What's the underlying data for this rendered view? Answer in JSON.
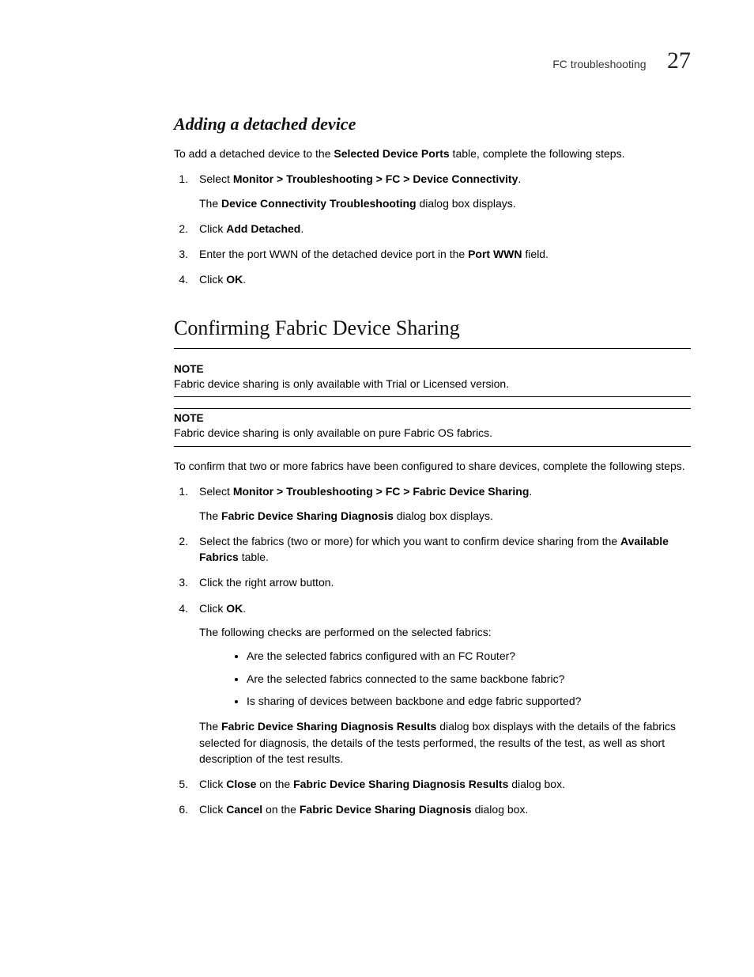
{
  "header": {
    "running_title": "FC troubleshooting",
    "chapter_number": "27"
  },
  "section1": {
    "heading": "Adding a detached device",
    "intro_pre": "To add a detached device to the ",
    "intro_bold": "Selected Device Ports",
    "intro_post": " table, complete the following steps.",
    "steps": {
      "s1_pre": "Select ",
      "s1_bold": "Monitor > Troubleshooting > FC > Device Connectivity",
      "s1_post": ".",
      "s1_sub_pre": "The ",
      "s1_sub_bold": "Device Connectivity Troubleshooting",
      "s1_sub_post": " dialog box displays.",
      "s2_pre": "Click ",
      "s2_bold": "Add Detached",
      "s2_post": ".",
      "s3_pre": "Enter the port WWN of the detached device port in the ",
      "s3_bold": "Port WWN",
      "s3_post": " field.",
      "s4_pre": "Click ",
      "s4_bold": "OK",
      "s4_post": "."
    }
  },
  "section2": {
    "heading": "Confirming Fabric Device Sharing",
    "note1": {
      "label": "NOTE",
      "text": "Fabric device sharing is only available with Trial or Licensed version."
    },
    "note2": {
      "label": "NOTE",
      "text": "Fabric device sharing is only available on pure Fabric OS fabrics."
    },
    "intro": "To confirm that two or more fabrics have been configured to share devices, complete the following steps.",
    "steps": {
      "s1_pre": "Select ",
      "s1_bold": "Monitor > Troubleshooting > FC > Fabric Device Sharing",
      "s1_post": ".",
      "s1_sub_pre": "The ",
      "s1_sub_bold": "Fabric Device Sharing Diagnosis",
      "s1_sub_post": " dialog box displays.",
      "s2_pre": "Select the fabrics (two or more) for which you want to confirm device sharing from the ",
      "s2_bold": "Available Fabrics",
      "s2_post": " table.",
      "s3": "Click the right arrow button.",
      "s4_pre": "Click ",
      "s4_bold": "OK",
      "s4_post": ".",
      "s4_sub": "The following checks are performed on the selected fabrics:",
      "bullets": {
        "b1": "Are the selected fabrics configured with an FC Router?",
        "b2": "Are the selected fabrics connected to the same backbone fabric?",
        "b3": "Is sharing of devices between backbone and edge fabric supported?"
      },
      "s4_result_pre": "The ",
      "s4_result_bold": "Fabric Device Sharing Diagnosis Results",
      "s4_result_post": " dialog box displays with the details of the fabrics selected for diagnosis, the details of the tests performed, the results of the test, as well as short description of the test results.",
      "s5_pre": "Click ",
      "s5_bold1": "Close",
      "s5_mid": " on the ",
      "s5_bold2": "Fabric Device Sharing Diagnosis Results",
      "s5_post": " dialog box.",
      "s6_pre": "Click ",
      "s6_bold1": "Cancel",
      "s6_mid": " on the ",
      "s6_bold2": "Fabric Device Sharing Diagnosis",
      "s6_post": " dialog box."
    }
  }
}
